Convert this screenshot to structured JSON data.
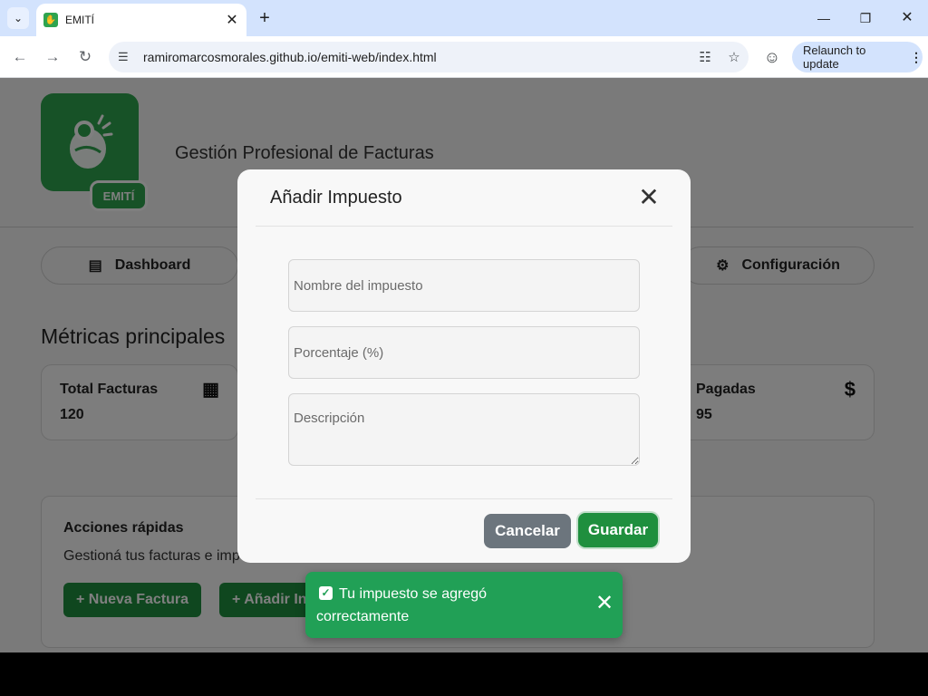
{
  "browser": {
    "tab_title": "EMITÍ",
    "url": "ramiromarcosmorales.github.io/emiti-web/index.html",
    "relaunch_label": "Relaunch to update"
  },
  "header": {
    "logo_text": "EMITÍ",
    "tagline": "Gestión Profesional de Facturas"
  },
  "nav": {
    "dashboard_label": "Dashboard",
    "config_label": "Configuración"
  },
  "metrics": {
    "section_title": "Métricas principales",
    "total_label": "Total Facturas",
    "total_value": "120",
    "paid_label": "Pagadas",
    "paid_value": "95"
  },
  "quick_actions": {
    "title": "Acciones rápidas",
    "subtitle": "Gestioná tus facturas e imp",
    "new_invoice_label": "+ Nueva Factura",
    "add_tax_label": "+ Añadir In"
  },
  "modal": {
    "title": "Añadir Impuesto",
    "name_placeholder": "Nombre del impuesto",
    "percent_placeholder": "Porcentaje (%)",
    "description_placeholder": "Descripción",
    "cancel_label": "Cancelar",
    "save_label": "Guardar"
  },
  "toast": {
    "message": "Tu impuesto se agregó correctamente"
  },
  "colors": {
    "brand_green": "#2ea44f",
    "button_green": "#1f8f3e",
    "toast_green": "#21a056",
    "cancel_gray": "#6c757d"
  }
}
